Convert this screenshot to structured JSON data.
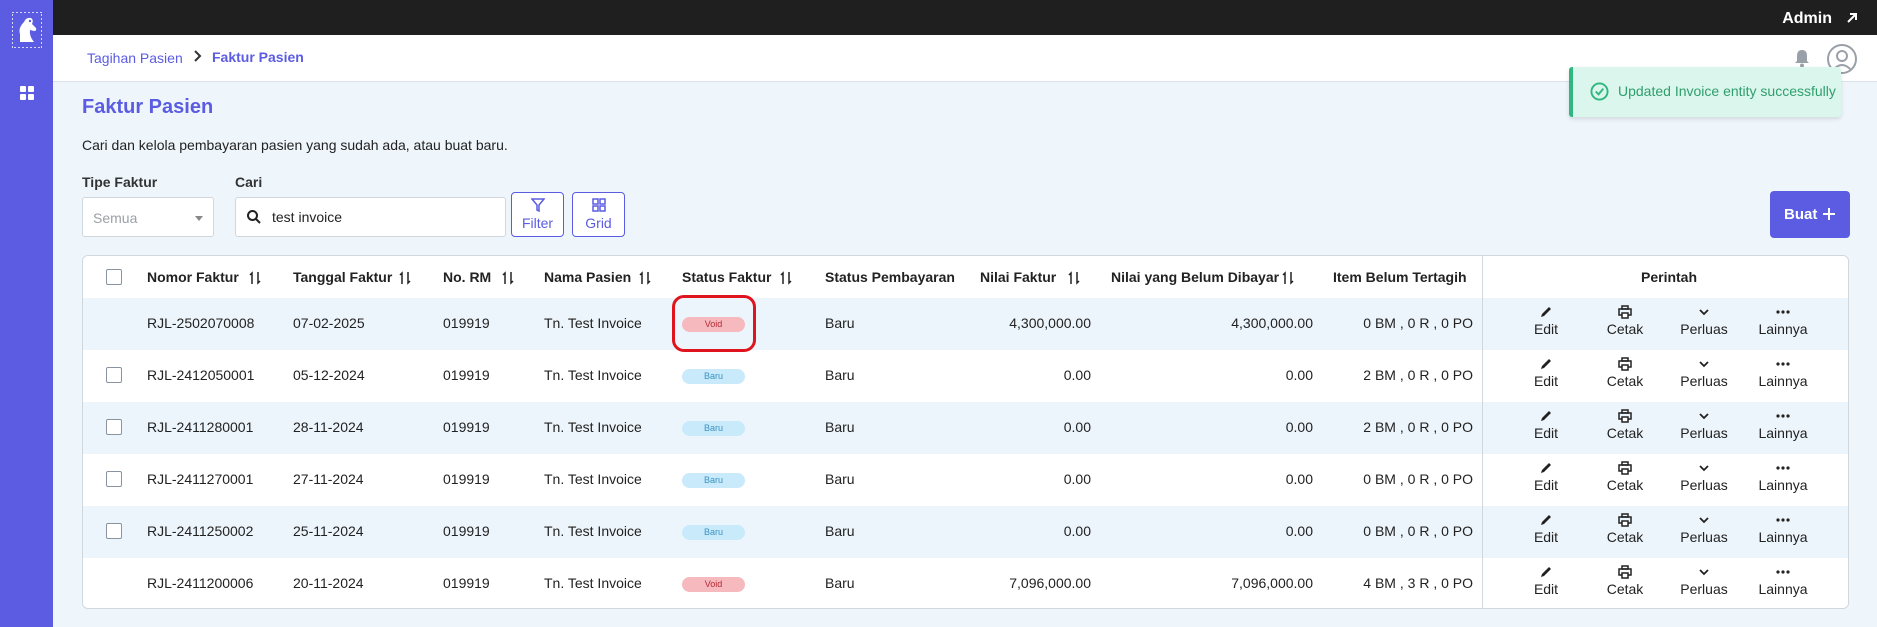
{
  "colors": {
    "brand": "#5b5ce2",
    "topbar": "#1f1f1f",
    "void_badge": "#f6b9bd",
    "baru_badge": "#c9eafa",
    "toast_bg": "#dbf6ec",
    "highlight_ring": "#e0141e"
  },
  "topbar": {
    "user": "Admin"
  },
  "breadcrumb": {
    "parent": "Tagihan Pasien",
    "current": "Faktur Pasien"
  },
  "toast": {
    "message": "Updated Invoice entity successfully",
    "icon": "check-circle-icon"
  },
  "page": {
    "title": "Faktur Pasien",
    "subtitle": "Cari dan kelola pembayaran pasien yang sudah ada, atau buat baru."
  },
  "filters": {
    "type_label": "Tipe Faktur",
    "type_value": "Semua",
    "search_label": "Cari",
    "search_value": "test invoice",
    "filter_button": "Filter",
    "grid_button": "Grid",
    "create_button": "Buat"
  },
  "table": {
    "headers": {
      "invoice_no": "Nomor Faktur",
      "invoice_date": "Tanggal Faktur",
      "rm_no": "No. RM",
      "patient_name": "Nama Pasien",
      "invoice_status": "Status Faktur",
      "payment_status": "Status Pembayaran",
      "invoice_value": "Nilai Faktur",
      "unpaid_value": "Nilai yang Belum Dibayar",
      "unbilled_items": "Item Belum Tertagih",
      "actions": "Perintah"
    },
    "actions": {
      "edit": "Edit",
      "print": "Cetak",
      "expand": "Perluas",
      "more": "Lainnya"
    },
    "rows": [
      {
        "invoice_no": "RJL-2502070008",
        "invoice_date": "07-02-2025",
        "rm_no": "019919",
        "patient_name": "Tn. Test Invoice",
        "status": "Void",
        "payment_status": "Baru",
        "value": "4,300,000.00",
        "unpaid": "4,300,000.00",
        "unbilled": "0 BM , 0 R , 0 PO",
        "checkbox": false
      },
      {
        "invoice_no": "RJL-2412050001",
        "invoice_date": "05-12-2024",
        "rm_no": "019919",
        "patient_name": "Tn. Test Invoice",
        "status": "Baru",
        "payment_status": "Baru",
        "value": "0.00",
        "unpaid": "0.00",
        "unbilled": "2 BM , 0 R , 0 PO",
        "checkbox": true
      },
      {
        "invoice_no": "RJL-2411280001",
        "invoice_date": "28-11-2024",
        "rm_no": "019919",
        "patient_name": "Tn. Test Invoice",
        "status": "Baru",
        "payment_status": "Baru",
        "value": "0.00",
        "unpaid": "0.00",
        "unbilled": "2 BM , 0 R , 0 PO",
        "checkbox": true
      },
      {
        "invoice_no": "RJL-2411270001",
        "invoice_date": "27-11-2024",
        "rm_no": "019919",
        "patient_name": "Tn. Test Invoice",
        "status": "Baru",
        "payment_status": "Baru",
        "value": "0.00",
        "unpaid": "0.00",
        "unbilled": "0 BM , 0 R , 0 PO",
        "checkbox": true
      },
      {
        "invoice_no": "RJL-2411250002",
        "invoice_date": "25-11-2024",
        "rm_no": "019919",
        "patient_name": "Tn. Test Invoice",
        "status": "Baru",
        "payment_status": "Baru",
        "value": "0.00",
        "unpaid": "0.00",
        "unbilled": "0 BM , 0 R , 0 PO",
        "checkbox": true
      },
      {
        "invoice_no": "RJL-2411200006",
        "invoice_date": "20-11-2024",
        "rm_no": "019919",
        "patient_name": "Tn. Test Invoice",
        "status": "Void",
        "payment_status": "Baru",
        "value": "7,096,000.00",
        "unpaid": "7,096,000.00",
        "unbilled": "4 BM , 3 R , 0 PO",
        "checkbox": false
      }
    ]
  }
}
